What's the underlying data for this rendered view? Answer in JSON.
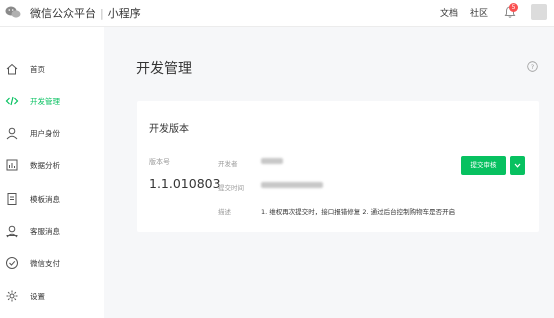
{
  "header": {
    "platform_name": "微信公众平台",
    "separator": "|",
    "app_type": "小程序",
    "docs_link": "文档",
    "community_link": "社区",
    "notification_count": "5"
  },
  "sidebar": {
    "items": [
      {
        "label": "首页",
        "icon": "home-icon"
      },
      {
        "label": "开发管理",
        "icon": "code-icon",
        "active": true
      },
      {
        "label": "用户身份",
        "icon": "user-icon"
      },
      {
        "label": "数据分析",
        "icon": "chart-icon"
      },
      {
        "label": "模板消息",
        "icon": "document-icon"
      },
      {
        "label": "客服消息",
        "icon": "service-icon"
      },
      {
        "label": "微信支付",
        "icon": "pay-icon"
      },
      {
        "label": "设置",
        "icon": "gear-icon"
      }
    ]
  },
  "main": {
    "title": "开发管理",
    "dev_version": {
      "section_title": "开发版本",
      "version_label": "版本号",
      "version_number": "1.1.010803",
      "developer_label": "开发者",
      "submit_time_label": "提交时间",
      "description_label": "描述",
      "description": "1. 维权再次提交时，接口报错修复 2. 通过后台控制购物车是否开启",
      "submit_button": "提交审核"
    }
  },
  "colors": {
    "accent": "#07c160",
    "badge": "#fa5151",
    "background": "#f6f7f9"
  }
}
